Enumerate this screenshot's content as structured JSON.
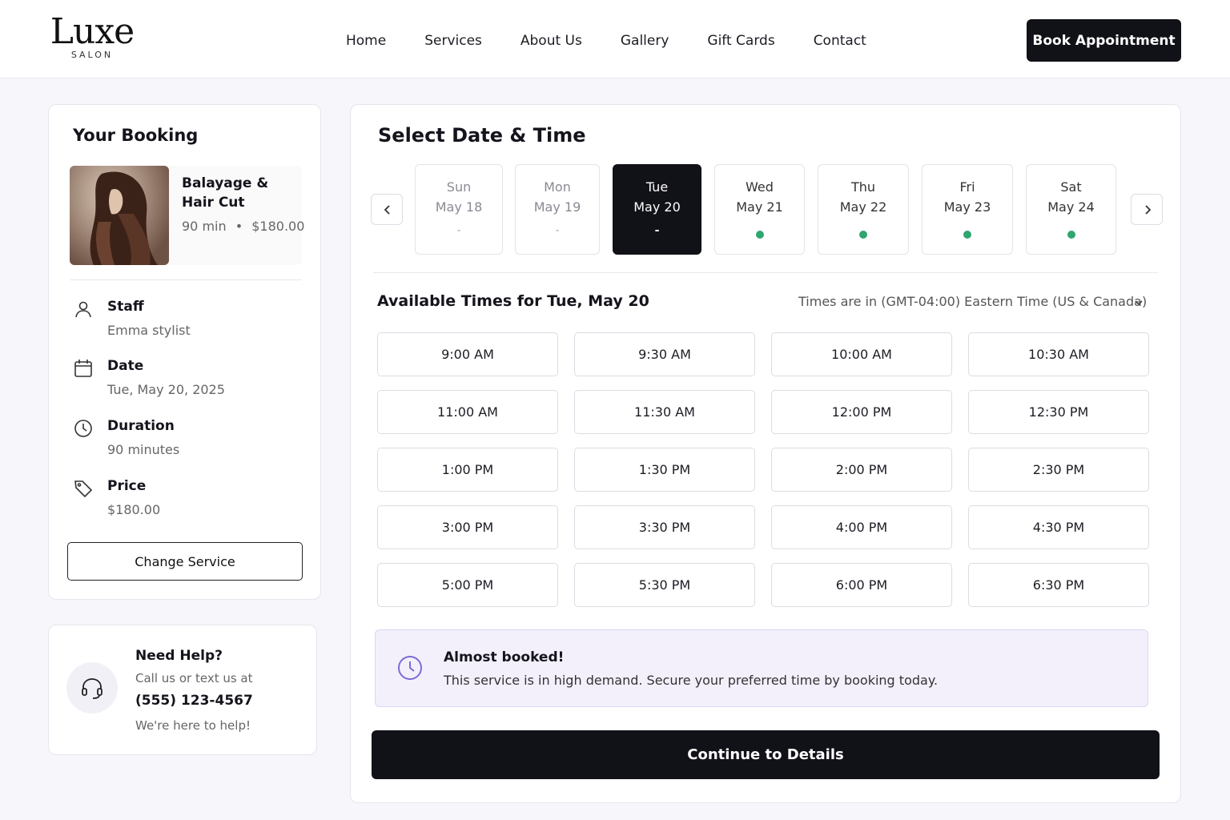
{
  "brand": {
    "name": "Luxe",
    "tagline": "SALON"
  },
  "nav": {
    "items": [
      "Home",
      "Services",
      "About Us",
      "Gallery",
      "Gift Cards",
      "Contact"
    ],
    "cta": "Book Appointment"
  },
  "booking": {
    "title": "Your Booking",
    "service": {
      "name": "Balayage & Hair Cut",
      "duration": "90 min",
      "separator": "•",
      "price": "$180.00"
    },
    "details": [
      {
        "icon": "user-icon",
        "label": "Staff",
        "value": "Emma stylist"
      },
      {
        "icon": "calendar-icon",
        "label": "Date",
        "value": "Tue, May 20, 2025"
      },
      {
        "icon": "clock-icon",
        "label": "Duration",
        "value": "90 minutes"
      },
      {
        "icon": "tag-icon",
        "label": "Price",
        "value": "$180.00"
      }
    ],
    "change_label": "Change Service"
  },
  "help": {
    "icon": "headset-icon",
    "title": "Need Help?",
    "subtitle": "Call us or text us at",
    "phone": "(555) 123-4567",
    "footer": "We're here to help!"
  },
  "schedule": {
    "title": "Select Date & Time",
    "days": [
      {
        "name": "Sun",
        "date": "May 18",
        "mark": "-",
        "available": false,
        "selected": false
      },
      {
        "name": "Mon",
        "date": "May 19",
        "mark": "-",
        "available": false,
        "selected": false
      },
      {
        "name": "Tue",
        "date": "May 20",
        "mark": "-",
        "available": false,
        "selected": true
      },
      {
        "name": "Wed",
        "date": "May 21",
        "mark": "",
        "available": true,
        "selected": false
      },
      {
        "name": "Thu",
        "date": "May 22",
        "mark": "",
        "available": true,
        "selected": false
      },
      {
        "name": "Fri",
        "date": "May 23",
        "mark": "",
        "available": true,
        "selected": false
      },
      {
        "name": "Sat",
        "date": "May 24",
        "mark": "",
        "available": true,
        "selected": false
      }
    ],
    "available_title": "Available Times for Tue, May 20",
    "timezone": "Times are in (GMT-04:00) Eastern Time (US & Canada)",
    "slots": [
      "9:00 AM",
      "9:30 AM",
      "10:00 AM",
      "10:30 AM",
      "11:00 AM",
      "11:30 AM",
      "12:00 PM",
      "12:30 PM",
      "1:00 PM",
      "1:30 PM",
      "2:00 PM",
      "2:30 PM",
      "3:00 PM",
      "3:30 PM",
      "4:00 PM",
      "4:30 PM",
      "5:00 PM",
      "5:30 PM",
      "6:00 PM",
      "6:30 PM"
    ],
    "banner": {
      "title": "Almost booked!",
      "text": "This service is in high demand. Secure your preferred time by booking today."
    },
    "continue_label": "Continue to Details"
  },
  "colors": {
    "primary": "#111118",
    "available_dot": "#2fa56f",
    "accent_purple": "#7b6bd6",
    "banner_bg": "#f3f0fc"
  }
}
